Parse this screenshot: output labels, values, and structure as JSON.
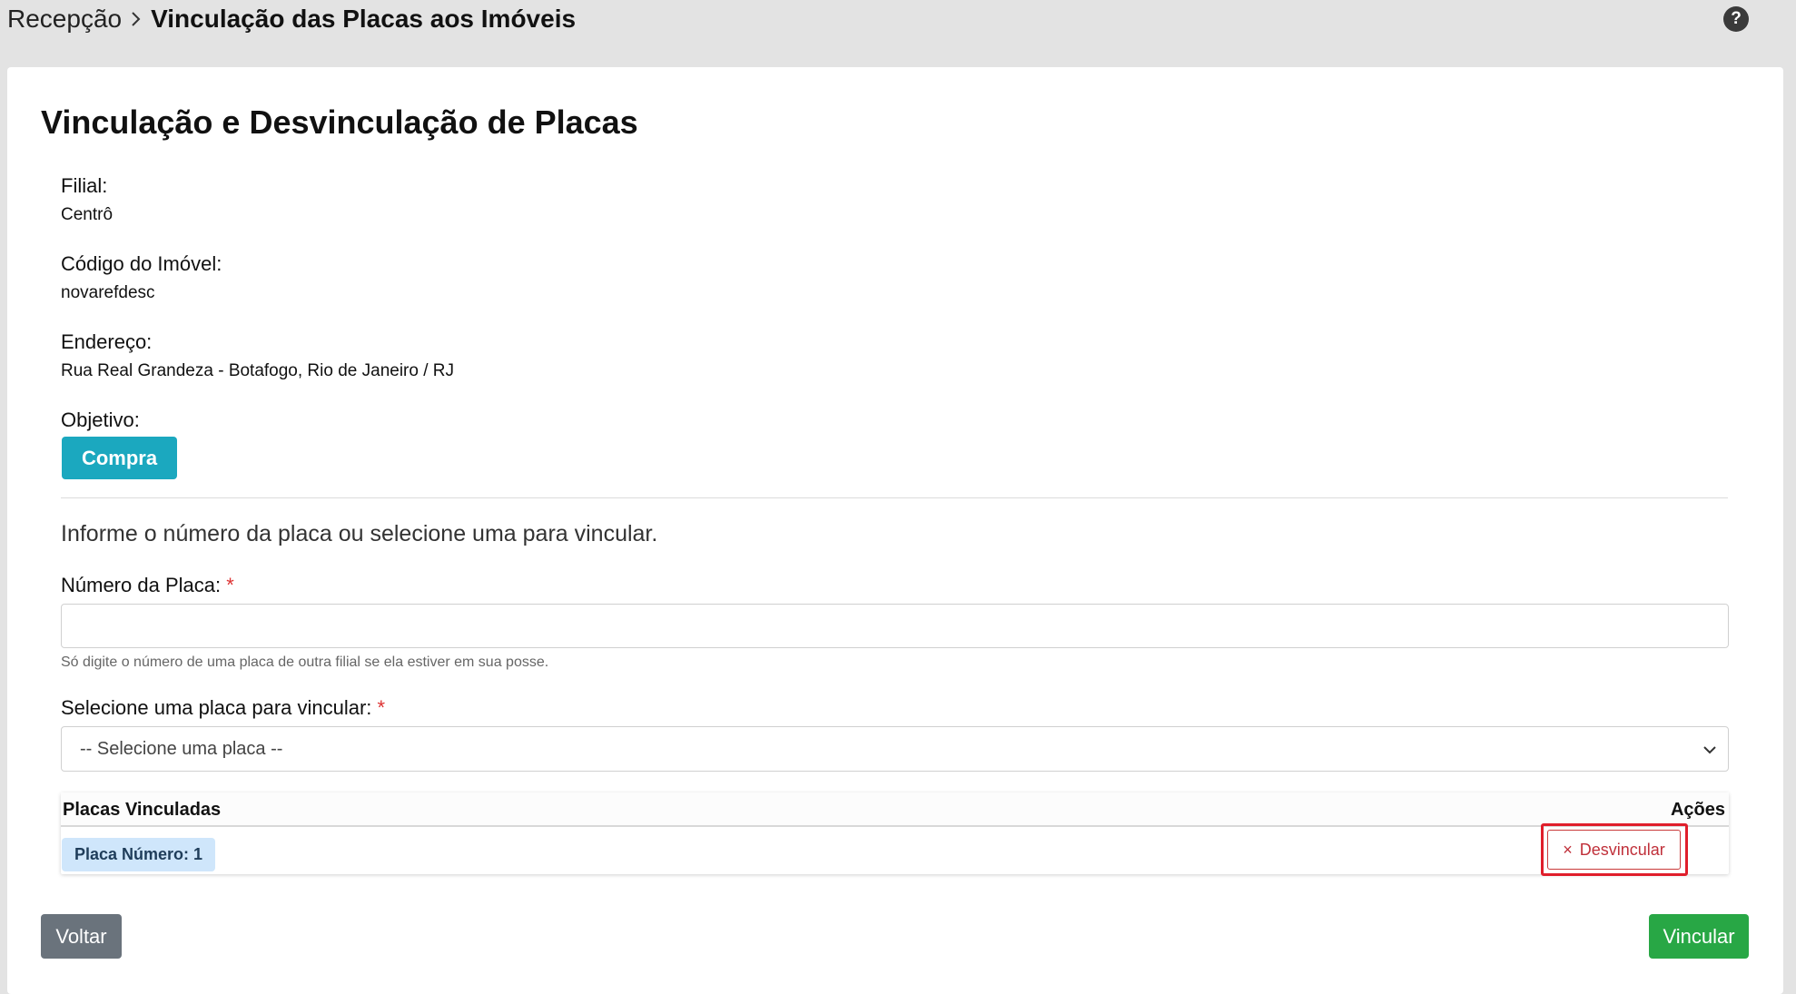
{
  "breadcrumb": {
    "root": "Recepção",
    "current": "Vinculação das Placas aos Imóveis"
  },
  "help_icon": "?",
  "page_title": "Vinculação e Desvinculação de Placas",
  "info": {
    "filial_label": "Filial:",
    "filial_value": "Centrô",
    "codigo_label": "Código do Imóvel:",
    "codigo_value": "novarefdesc",
    "endereco_label": "Endereço:",
    "endereco_value": "Rua Real Grandeza - Botafogo, Rio de Janeiro / RJ",
    "objetivo_label": "Objetivo:",
    "objetivo_value": "Compra"
  },
  "form": {
    "instruction": "Informe o número da placa ou selecione uma para vincular.",
    "numero_label": "Número da Placa:",
    "required_mark": "*",
    "numero_value": "",
    "numero_help": "Só digite o número de uma placa de outra filial se ela estiver em sua posse.",
    "select_label": "Selecione uma placa para vincular:",
    "select_value": "-- Selecione uma placa --"
  },
  "table": {
    "header_left": "Placas Vinculadas",
    "header_right": "Ações",
    "rows": [
      {
        "placa": "Placa Número: 1",
        "action": "Desvincular",
        "action_icon": "×"
      }
    ]
  },
  "footer": {
    "voltar": "Voltar",
    "vincular": "Vincular"
  },
  "colors": {
    "info_badge": "#1ba8bf",
    "success": "#28a745",
    "secondary": "#6a737c",
    "danger": "#c0303a",
    "highlight": "#e01e2b"
  }
}
